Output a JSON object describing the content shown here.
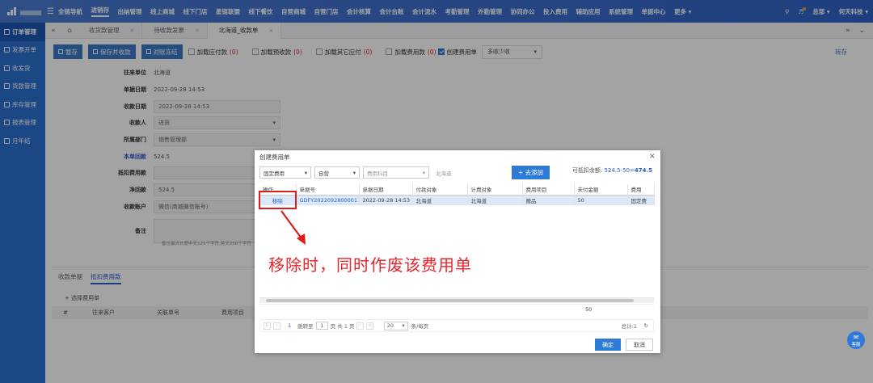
{
  "top_nav": {
    "items": [
      "全链导航",
      "进销存",
      "出纳管理",
      "线上商城",
      "线下门店",
      "星链联盟",
      "线下餐饮",
      "自营商城",
      "自营门店",
      "会计核算",
      "会计台账",
      "会计流水",
      "考勤管理",
      "外勤管理",
      "协同办公",
      "投入费用",
      "辅助应用",
      "系统管理",
      "单据中心",
      "更多 ▾"
    ],
    "active_index": 1,
    "user": "总部 ▾",
    "company": "何天科技 ▾"
  },
  "sidebar": {
    "items": [
      {
        "label": "订单管理",
        "icon": "order-icon",
        "active": true
      },
      {
        "label": "发票开单",
        "icon": "invoice-icon"
      },
      {
        "label": "收发货",
        "icon": "shipping-icon"
      },
      {
        "label": "货款管理",
        "icon": "payment-icon"
      },
      {
        "label": "库存管理",
        "icon": "inventory-icon"
      },
      {
        "label": "报表管理",
        "icon": "report-icon"
      },
      {
        "label": "月年结",
        "icon": "calendar-icon"
      }
    ]
  },
  "tabs": {
    "items": [
      "收货款管理",
      "待收款发票",
      "北海道_收款单"
    ],
    "active_index": 2
  },
  "toolbar": {
    "save": "暂存",
    "save_receive": "保存并收款",
    "settle": "对账冻结",
    "chk_payable": "加载应付款",
    "chk_payable_count": "(0)",
    "chk_prepay": "加载预收款",
    "chk_prepay_count": "(0)",
    "chk_other_payable": "加载其它应付",
    "chk_other_payable_count": "(0)",
    "chk_fee": "加载费用款",
    "chk_fee_count": "(0)",
    "create_fee": "创建费用单",
    "mode_select": "多收少收",
    "right_link": "转存"
  },
  "form": {
    "fields": [
      {
        "label": "往来单位",
        "value": "北海道",
        "type": "plain"
      },
      {
        "label": "单据日期",
        "value": "2022-09-28 14:53",
        "type": "plain"
      },
      {
        "label": "收款日期",
        "value": "2022-09-28 14:53",
        "type": "input"
      },
      {
        "label": "收款人",
        "value": "进货",
        "type": "select"
      },
      {
        "label": "所属部门",
        "value": "销售管理部",
        "type": "select"
      },
      {
        "label": "本单回款",
        "value": "524.5",
        "type": "plain",
        "highlight": true
      },
      {
        "label": "抵扣费用款",
        "value": "",
        "type": "input"
      },
      {
        "label": "净回款",
        "value": "524.5",
        "type": "input"
      },
      {
        "label": "收款账户",
        "value": "微信(商城微信账号)",
        "type": "select"
      },
      {
        "label": "备注",
        "value": "",
        "type": "textarea"
      }
    ],
    "note": "备注最大长度中文125个字符,英文250个字符"
  },
  "bottom": {
    "tabs": [
      "收款单据",
      "抵扣费用款"
    ],
    "active_index": 1,
    "add_label": "+ 选择费用单",
    "columns": [
      "#",
      "往来客户",
      "关联单号",
      "费用项目"
    ]
  },
  "modal": {
    "title": "创建费用单",
    "filters": {
      "type": "固定费用",
      "channel": "自营",
      "subject_placeholder": "费用科目",
      "partner": "北海道",
      "add_button": "+ 去添加"
    },
    "available_label": "可抵扣余额:",
    "available_formula": "524.5-50=",
    "available_value": "474.5",
    "columns": [
      "操作",
      "单据号",
      "单据日期",
      "付款对象",
      "计费对象",
      "费用项目",
      "未付金额",
      "费用"
    ],
    "rows": [
      {
        "action": "移除",
        "doc_no": "GDFY2022092800001",
        "date": "2022-09-28 14:53",
        "payee": "北海道",
        "billed": "北海道",
        "item": "赠品",
        "unpaid": "50",
        "fee": "固定费"
      }
    ],
    "sum_unpaid": "50",
    "pager": {
      "current_page": "1",
      "goto_label": "跳转至",
      "goto_value": "1",
      "page_word": "页",
      "total_pages": "共 1 页",
      "page_size": "20",
      "per_page_label": "条/每页",
      "total": "总计:1"
    },
    "ok": "确定",
    "cancel": "取消"
  },
  "annotation": {
    "text": "移除时，同时作废该费用单",
    "color": "#e8252b"
  },
  "chat_widget": "客服"
}
